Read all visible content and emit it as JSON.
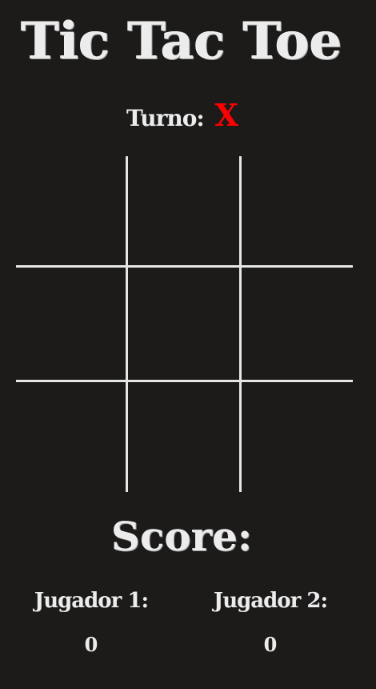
{
  "title": "Tic Tac Toe",
  "turn": {
    "label": "Turno:",
    "value": "X",
    "value_color": "#ff0000"
  },
  "board": {
    "cells": [
      "",
      "",
      "",
      "",
      "",
      "",
      "",
      "",
      ""
    ]
  },
  "score": {
    "title": "Score:",
    "players": [
      {
        "label": "Jugador 1:",
        "value": "0"
      },
      {
        "label": "Jugador 2:",
        "value": "0"
      }
    ]
  }
}
